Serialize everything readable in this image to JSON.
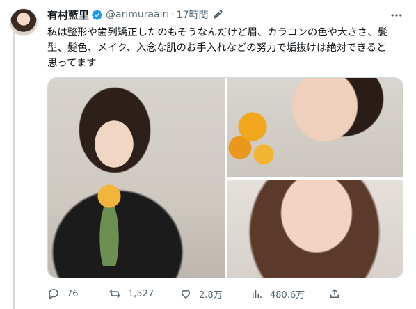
{
  "tweet": {
    "author_name": "有村藍里",
    "handle": "@arimuraairi",
    "separator": "·",
    "time": "17時間",
    "text_lines": [
      "私は整形や歯列矯正したのもそうなんだけど眉、カラコンの色や大きさ、髪",
      "型、髪色、メイク、入念な肌のお手入れなどの努力で垢抜けは絶対できると",
      "思ってます"
    ],
    "actions": {
      "reply_count": "76",
      "retweet_count": "1,527",
      "like_count": "2.8万",
      "views_count": "480.6万"
    }
  },
  "icons": {
    "verified": "verified-badge-icon",
    "edit": "edited-pencil-icon",
    "more": "more-options-icon",
    "reply": "reply-icon",
    "retweet": "retweet-icon",
    "like": "like-heart-icon",
    "views": "views-chart-icon",
    "share": "share-icon"
  },
  "colors": {
    "verified_blue": "#1d9bf0",
    "secondary_text": "#536471",
    "primary_text": "#0f1419"
  }
}
